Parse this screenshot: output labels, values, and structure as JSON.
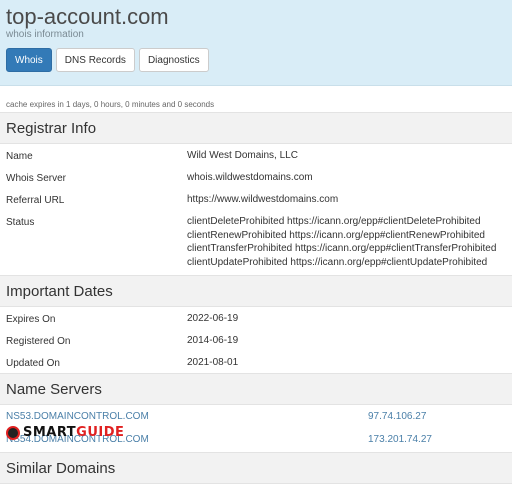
{
  "header": {
    "domain": "top-account.com",
    "subtitle": "whois information",
    "tabs": [
      "Whois",
      "DNS Records",
      "Diagnostics"
    ],
    "active_tab": "Whois"
  },
  "cache_text": "cache expires in 1 days, 0 hours, 0 minutes and 0 seconds",
  "registrar": {
    "heading": "Registrar Info",
    "rows": [
      {
        "label": "Name",
        "value": "Wild West Domains, LLC"
      },
      {
        "label": "Whois Server",
        "value": "whois.wildwestdomains.com"
      },
      {
        "label": "Referral URL",
        "value": "https://www.wildwestdomains.com"
      }
    ],
    "status_label": "Status",
    "status_lines": [
      "clientDeleteProhibited https://icann.org/epp#clientDeleteProhibited",
      "clientRenewProhibited https://icann.org/epp#clientRenewProhibited",
      "clientTransferProhibited https://icann.org/epp#clientTransferProhibited",
      "clientUpdateProhibited https://icann.org/epp#clientUpdateProhibited"
    ]
  },
  "dates": {
    "heading": "Important Dates",
    "rows": [
      {
        "label": "Expires On",
        "value": "2022-06-19"
      },
      {
        "label": "Registered On",
        "value": "2014-06-19"
      },
      {
        "label": "Updated On",
        "value": "2021-08-01"
      }
    ]
  },
  "nameservers": {
    "heading": "Name Servers",
    "rows": [
      {
        "host": "NS53.DOMAINCONTROL.COM",
        "ip": "97.74.106.27"
      },
      {
        "host": "NS54.DOMAINCONTROL.COM",
        "ip": "173.201.74.27"
      }
    ]
  },
  "similar": {
    "heading": "Similar Domains"
  },
  "watermark": {
    "part1": "SMART",
    "part2": "GUIDE"
  },
  "colors": {
    "header_bg": "#d9edf7",
    "active_tab": "#337ab7",
    "link": "#4a7fa8"
  }
}
